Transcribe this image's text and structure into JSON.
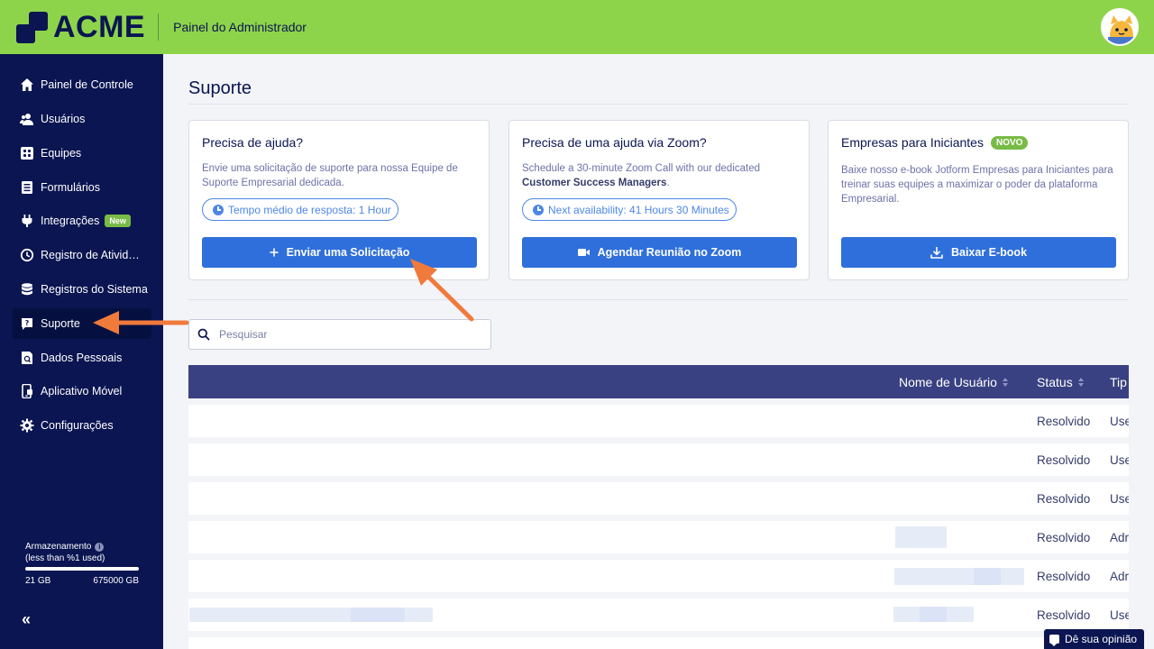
{
  "header": {
    "logo_text": "ACME",
    "title": "Painel do Administrador"
  },
  "sidebar": {
    "items": [
      {
        "label": "Painel de Controle",
        "icon": "home-icon"
      },
      {
        "label": "Usuários",
        "icon": "users-icon"
      },
      {
        "label": "Equipes",
        "icon": "teams-icon"
      },
      {
        "label": "Formulários",
        "icon": "forms-icon"
      },
      {
        "label": "Integrações",
        "icon": "plug-icon",
        "badge": "New"
      },
      {
        "label": "Registro de Atividades",
        "icon": "clock-history-icon"
      },
      {
        "label": "Registros do Sistema",
        "icon": "database-icon"
      },
      {
        "label": "Suporte",
        "icon": "support-icon",
        "active": true
      },
      {
        "label": "Dados Pessoais",
        "icon": "personal-data-icon"
      },
      {
        "label": "Aplicativo Móvel",
        "icon": "mobile-app-icon"
      },
      {
        "label": "Configurações",
        "icon": "gear-icon"
      }
    ],
    "storage": {
      "title": "Armazenamento",
      "subtitle": "(less than %1 used)",
      "used": "21 GB",
      "total": "675000 GB",
      "fraction_used": 0.01
    },
    "collapse_glyph": "«"
  },
  "main": {
    "page_title": "Suporte",
    "cards": [
      {
        "title": "Precisa de ajuda?",
        "description": "Envie uma solicitação de suporte para nossa Equipe de Suporte Empresarial dedicada.",
        "pill": "Tempo médio de resposta: 1 Hour",
        "button": "Enviar uma Solicitação",
        "button_icon": "plus-icon"
      },
      {
        "title": "Precisa de uma ajuda via Zoom?",
        "description_plain": "Schedule a 30-minute Zoom Call with our dedicated ",
        "description_bold": "Customer Success Managers",
        "description_end": ".",
        "pill": "Next availability: 41 Hours 30 Minutes",
        "button": "Agendar Reunião no Zoom",
        "button_icon": "video-camera-icon"
      },
      {
        "title": "Empresas para Iniciantes",
        "badge": "NOVO",
        "description": "Baixe nosso e-book Jotform Empresas para Iniciantes para treinar suas equipes a maximizar o poder da plataforma Empresarial.",
        "button": "Baixar E-book",
        "button_icon": "download-icon"
      }
    ],
    "search": {
      "placeholder": "Pesquisar"
    },
    "table": {
      "columns": [
        "Nome de Usuário",
        "Status",
        "Tip"
      ],
      "rows": [
        {
          "status": "Resolvido",
          "type": "Use"
        },
        {
          "status": "Resolvido",
          "type": "Use"
        },
        {
          "status": "Resolvido",
          "type": "Use"
        },
        {
          "status": "Resolvido",
          "type": "Adr"
        },
        {
          "status": "Resolvido",
          "type": "Adr"
        },
        {
          "status": "Resolvido",
          "type": "Use"
        }
      ]
    }
  },
  "feedback": {
    "label": "Dê sua opinião"
  },
  "colors": {
    "topbar": "#8ed44a",
    "sidebar": "#0a1551",
    "primary_button": "#2f6fdb",
    "table_header": "#3a4182",
    "annotation_arrow": "#f07a3c",
    "badge_green": "#78bb47"
  }
}
